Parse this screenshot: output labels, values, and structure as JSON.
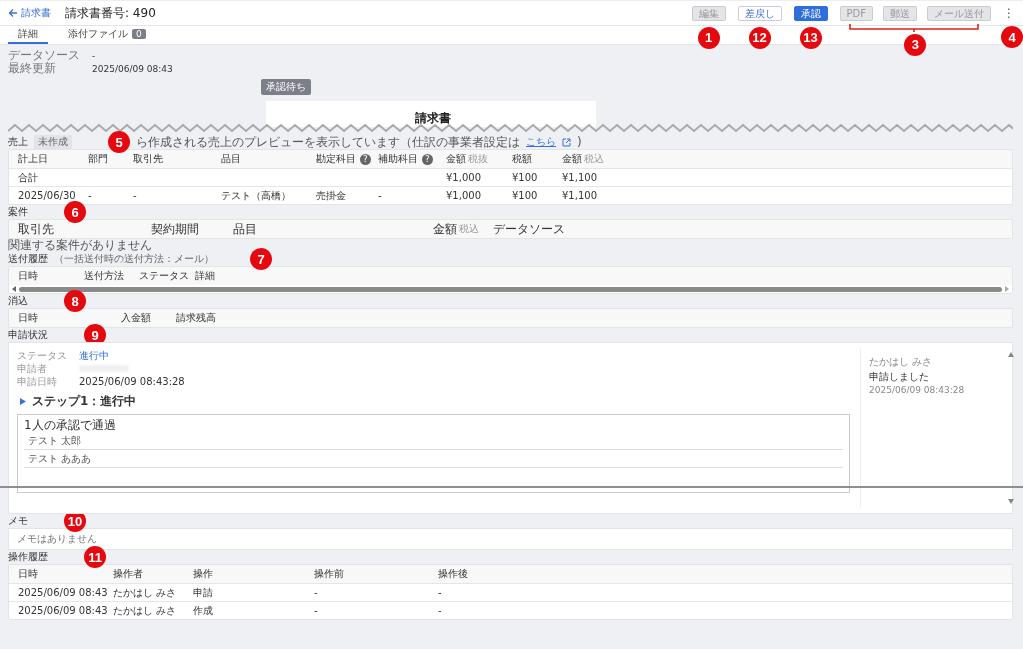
{
  "header": {
    "back_link": "請求書",
    "title": "請求書番号: 490",
    "actions": [
      {
        "label": "編集",
        "kind": "secondary",
        "disabled": true,
        "marker": "1"
      },
      {
        "label": "差戻し",
        "kind": "outline",
        "disabled": false,
        "marker": "12"
      },
      {
        "label": "承認",
        "kind": "primary",
        "disabled": false,
        "marker": "13"
      }
    ],
    "output_actions": {
      "marker": "3",
      "buttons": [
        {
          "label": "PDF",
          "disabled": true
        },
        {
          "label": "郵送",
          "disabled": true
        },
        {
          "label": "メール送付",
          "disabled": true
        }
      ]
    },
    "more_menu": {
      "glyph": "⋮",
      "marker": "4"
    }
  },
  "tabs": [
    {
      "label": "詳細",
      "selected": true
    },
    {
      "label": "添付ファイル",
      "count": "0",
      "selected": false
    }
  ],
  "meta": [
    {
      "label": "データソース",
      "value": "-"
    },
    {
      "label": "最終更新",
      "value": "2025/06/09 08:43"
    }
  ],
  "preview": {
    "badge": "承認待ち",
    "title": "請求書"
  },
  "sales": {
    "title": "売上",
    "status": "未作成",
    "marker": "5",
    "note": "ら作成される売上のプレビューを表示しています（仕訳の事業者設定は",
    "link": "こちら",
    "note_end": ")",
    "columns": [
      {
        "label": "計上日"
      },
      {
        "label": "部門"
      },
      {
        "label": "取引先"
      },
      {
        "label": "品目"
      },
      {
        "label": "勘定科目",
        "help": "?"
      },
      {
        "label": "補助科目",
        "help": "?"
      },
      {
        "label": "金額",
        "suffix": "税抜"
      },
      {
        "label": "税額"
      },
      {
        "label": "金額",
        "suffix": "税込"
      }
    ],
    "rows": [
      [
        "合計",
        null,
        null,
        null,
        null,
        null,
        "¥1,000",
        "¥100",
        "¥1,100"
      ],
      [
        "2025/06/30",
        "-",
        "-",
        "テスト（高橋）",
        "売掛金",
        "-",
        "¥1,000",
        "¥100",
        "¥1,100"
      ]
    ]
  },
  "deals": {
    "title": "案件",
    "marker": "6",
    "columns": [
      {
        "label": "取引先"
      },
      {
        "label": "契約期間"
      },
      {
        "label": "品目"
      },
      {
        "label": "金額",
        "suffix": "税込"
      },
      {
        "label": "データソース"
      }
    ],
    "empty": "関連する案件がありません"
  },
  "sending_history": {
    "title": "送付履歴",
    "subtitle": "（一括送付時の送付方法：メール）",
    "marker": "7",
    "columns": [
      "日時",
      "送付方法",
      "ステータス",
      "詳細"
    ]
  },
  "reconciliation": {
    "title": "消込",
    "marker": "8",
    "columns": [
      "日時",
      "入金額",
      "請求残高"
    ]
  },
  "application": {
    "title": "申請状況",
    "marker": "9",
    "fields": [
      {
        "label": "ステータス",
        "value": "進行中"
      },
      {
        "label": "申請者"
      },
      {
        "label": "申請日時",
        "value": "2025/06/09 08:43:28"
      }
    ],
    "step": {
      "label": "ステップ1：進行中",
      "expanded": false
    },
    "rule": "1人の承認で通過",
    "approvers": [
      "テスト 太郎",
      "テスト あああ"
    ],
    "timeline": [
      {
        "user": "たかはし みさ",
        "action": "申請しました",
        "time": "2025/06/09 08:43:28"
      }
    ]
  },
  "memo": {
    "title": "メモ",
    "marker": "10",
    "empty": "メモはありません"
  },
  "operation_history": {
    "title": "操作履歴",
    "marker": "11",
    "columns": [
      "日時",
      "操作者",
      "操作",
      "操作前",
      "操作後"
    ],
    "rows": [
      [
        "2025/06/09 08:43",
        "たかはし みさ",
        "申請",
        "-",
        "-"
      ],
      [
        "2025/06/09 08:43",
        "たかはし みさ",
        "作成",
        "-",
        "-"
      ]
    ]
  }
}
